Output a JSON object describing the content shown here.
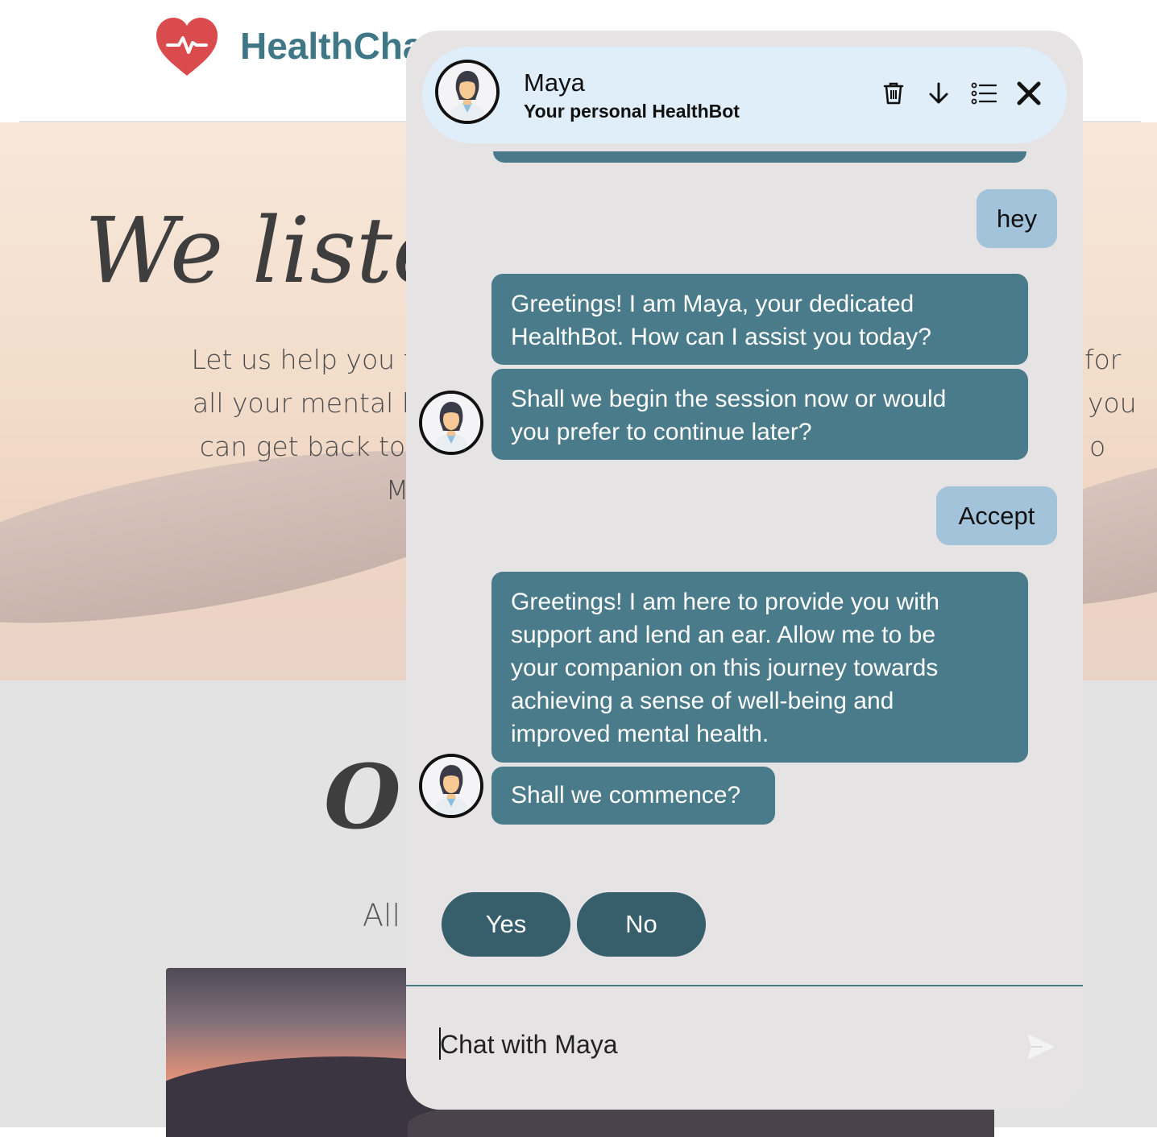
{
  "site": {
    "brand": "HealthCha",
    "hero_title": "We lister",
    "hero_lines": [
      "Let us help you find peace of m",
      "all your mental health needs. W",
      "can get back to feeling like yo",
      "M"
    ],
    "hero_right": [
      "for",
      "you",
      "o"
    ],
    "section_title": "Ou",
    "section_sub": "All"
  },
  "chat": {
    "bot_name": "Maya",
    "bot_subtitle": "Your personal HealthBot",
    "messages": {
      "user_1": "hey",
      "bot_1": {
        "line_1": "Greetings! I am Maya, your dedicated",
        "line_2": "HealthBot. How can I assist you today?"
      },
      "bot_2": {
        "line_1": "Shall we begin the session now or would",
        "line_2": "you prefer to continue later?"
      },
      "user_2": "Accept",
      "bot_3": {
        "line_1": "Greetings! I am here to provide you with",
        "line_2": "support and lend an ear. Allow me to be",
        "line_3": "your companion on this journey towards",
        "line_4": "achieving a sense of well-being and",
        "line_5": "improved mental health."
      },
      "bot_4": "Shall we commence?"
    },
    "quick_replies": [
      "Yes",
      "No"
    ],
    "input_placeholder": "Chat with Maya",
    "icons": {
      "delete": "trash-icon",
      "scroll": "arrow-down-icon",
      "menu": "list-icon",
      "close": "close-icon",
      "send": "send-icon"
    },
    "colors": {
      "bot_bubble": "#4a7b8a",
      "user_bubble": "#a2c3d9",
      "quick_reply": "#365f6b",
      "header_bg": "#dfeef8",
      "panel_bg": "#e5e3e4"
    }
  }
}
